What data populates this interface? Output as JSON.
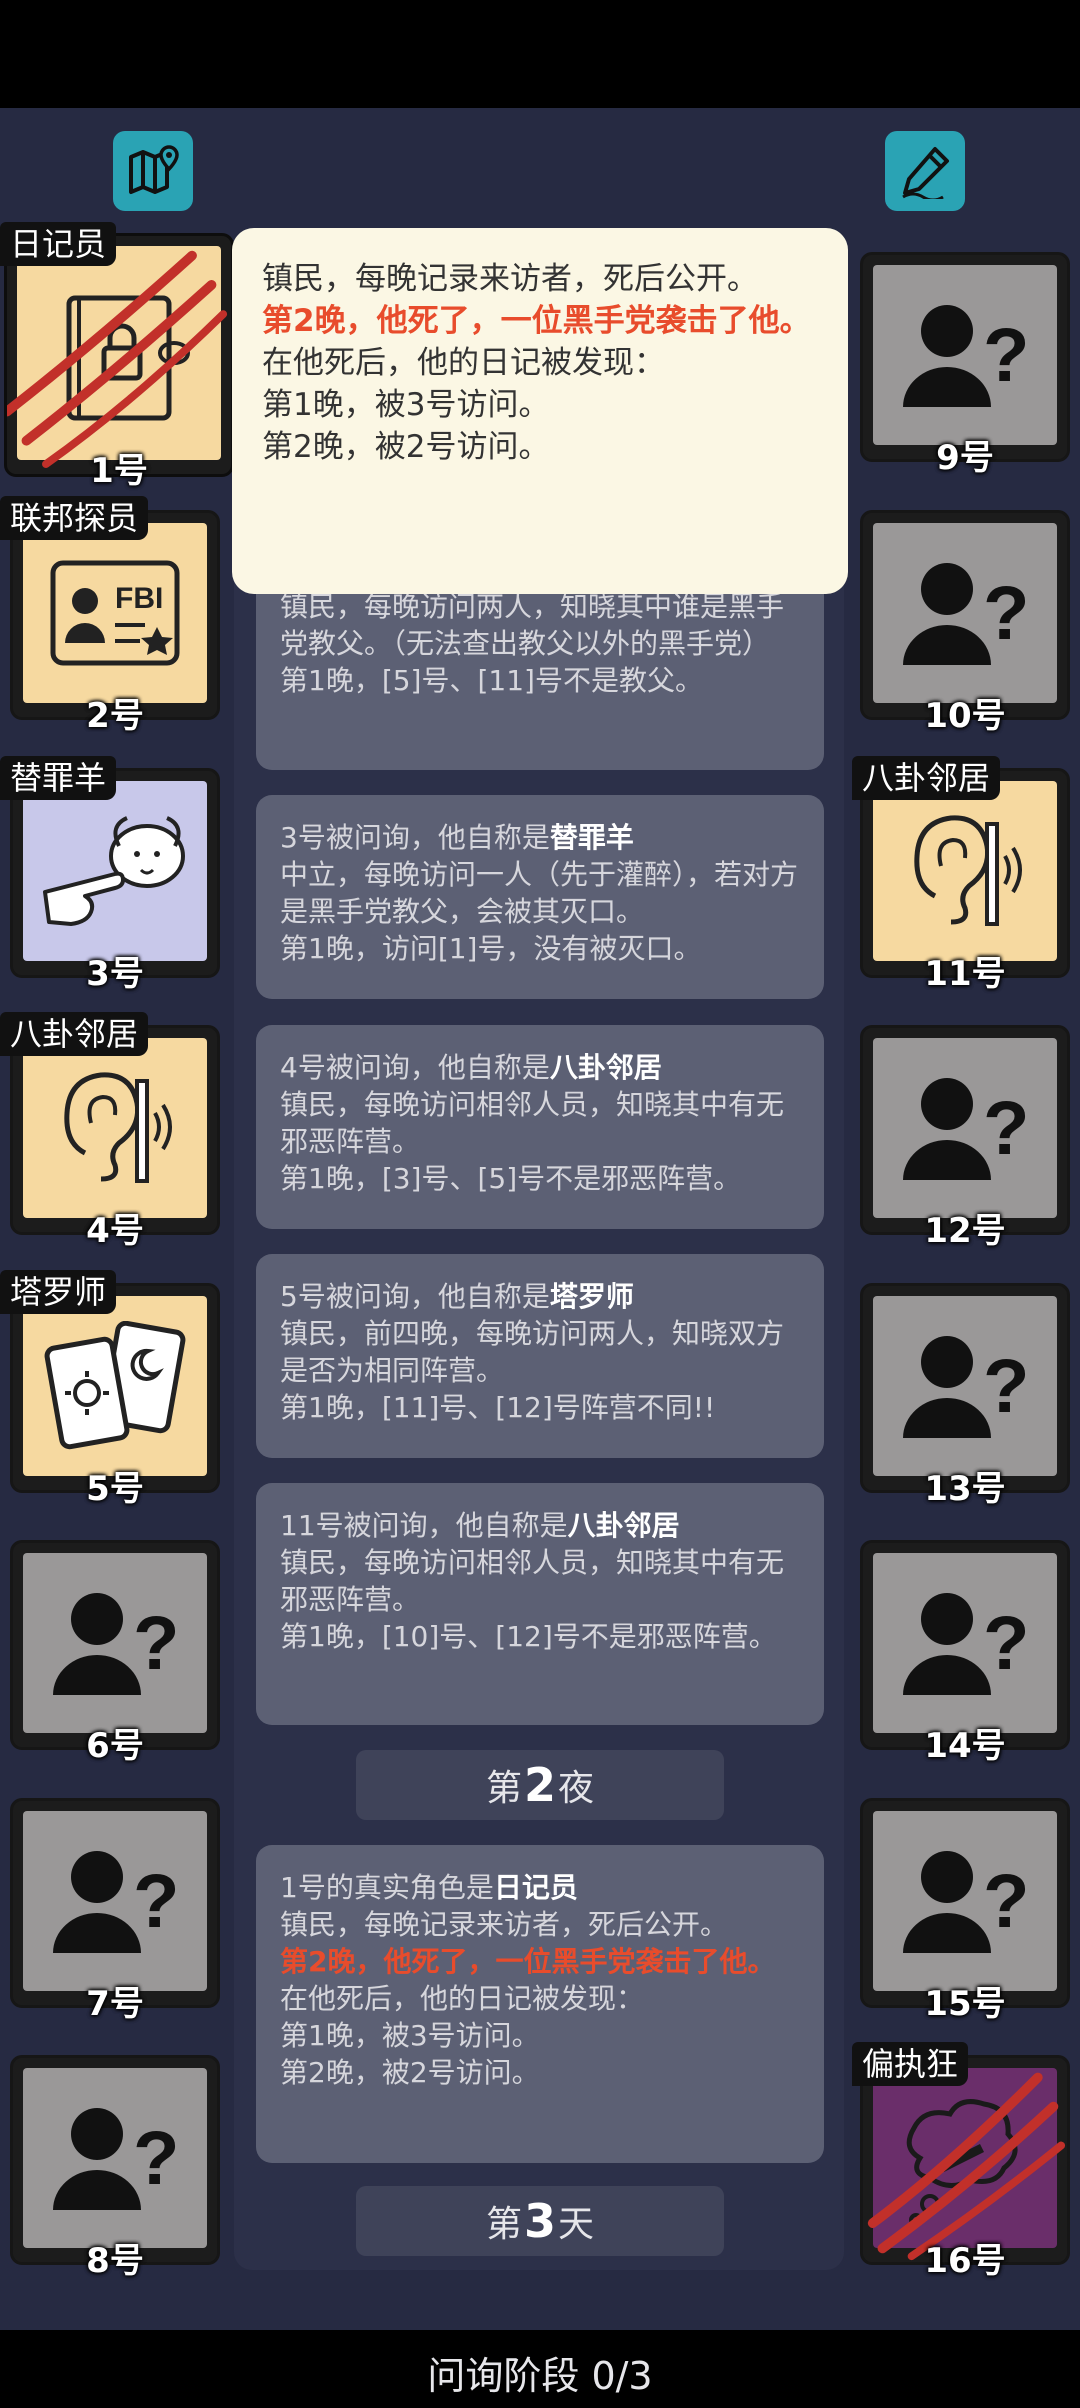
{
  "toolbar": {
    "map_icon": "map-pin-icon",
    "edit_icon": "pencil-icon"
  },
  "players": {
    "p1": {
      "num": "1号",
      "role": "日记员"
    },
    "p2": {
      "num": "2号",
      "role": "联邦探员"
    },
    "p3": {
      "num": "3号",
      "role": "替罪羊"
    },
    "p4": {
      "num": "4号",
      "role": "八卦邻居"
    },
    "p5": {
      "num": "5号",
      "role": "塔罗师"
    },
    "p6": {
      "num": "6号"
    },
    "p7": {
      "num": "7号"
    },
    "p8": {
      "num": "8号"
    },
    "p9": {
      "num": "9号"
    },
    "p10": {
      "num": "10号"
    },
    "p11": {
      "num": "11号",
      "role": "八卦邻居"
    },
    "p12": {
      "num": "12号"
    },
    "p13": {
      "num": "13号"
    },
    "p14": {
      "num": "14号"
    },
    "p15": {
      "num": "15号"
    },
    "p16": {
      "num": "16号",
      "role": "偏执狂"
    }
  },
  "popup": {
    "line1": "镇民，每晚记录来访者，死后公开。",
    "line2": "第2晚，他死了，一位黑手党袭击了他。",
    "line3": "在他死后，他的日记被发现：",
    "line4": "第1晚，被3号访问。",
    "line5": "第2晚，被2号访问。"
  },
  "log": {
    "e2": {
      "l1": "镇民，每晚访问两人，知晓其中谁是黑手党教父。（无法查出教父以外的黑手党）",
      "l2": "第1晚，[5]号、[11]号不是教父。"
    },
    "e3": {
      "prefix": "3号被问询，他自称是",
      "role": "替罪羊",
      "l1": "中立，每晚访问一人（先于灌醉），若对方是黑手党教父，会被其灭口。",
      "l2": "第1晚，访问[1]号，没有被灭口。"
    },
    "e4": {
      "prefix": "4号被问询，他自称是",
      "role": "八卦邻居",
      "l1": "镇民，每晚访问相邻人员，知晓其中有无邪恶阵营。",
      "l2": "第1晚，[3]号、[5]号不是邪恶阵营。"
    },
    "e5": {
      "prefix": "5号被问询，他自称是",
      "role": "塔罗师",
      "l1": "镇民，前四晚，每晚访问两人，知晓双方是否为相同阵营。",
      "l2": "第1晚，[11]号、[12]号阵营不同!!"
    },
    "e11": {
      "prefix": "11号被问询，他自称是",
      "role": "八卦邻居",
      "l1": "镇民，每晚访问相邻人员，知晓其中有无邪恶阵营。",
      "l2": "第1晚，[10]号、[12]号不是邪恶阵营。"
    },
    "night2": {
      "pre": "第",
      "n": "2",
      "post": "夜"
    },
    "e1": {
      "prefix": "1号的真实角色是",
      "role": "日记员",
      "l1": "镇民，每晚记录来访者，死后公开。",
      "red": "第2晚，他死了，一位黑手党袭击了他。",
      "l2": "在他死后，他的日记被发现：",
      "l3": "第1晚，被3号访问。",
      "l4": "第2晚，被2号访问。"
    },
    "day3": {
      "pre": "第",
      "n": "3",
      "post": "天"
    }
  },
  "status": {
    "phase_label": "问询阶段 0/3"
  }
}
